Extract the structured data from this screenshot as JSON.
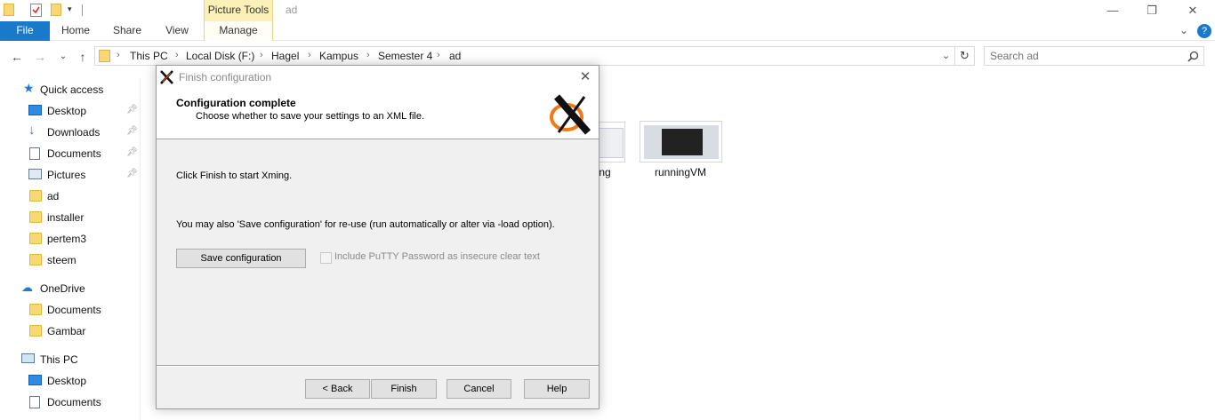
{
  "window": {
    "title": "ad",
    "context_tab": "Picture Tools",
    "controls": {
      "minimize": "—",
      "restore": "❐",
      "close": "✕"
    }
  },
  "ribbon": {
    "tabs": [
      "File",
      "Home",
      "Share",
      "View",
      "Manage"
    ],
    "expand_glyph": "⌄",
    "help_glyph": "?"
  },
  "address": {
    "crumbs": [
      "This PC",
      "Local Disk (F:)",
      "Hagel",
      "Kampus",
      "Semester 4",
      "ad"
    ],
    "search_placeholder": "Search ad"
  },
  "sidebar": {
    "quick_access": "Quick access",
    "quick_items": [
      {
        "label": "Desktop",
        "icon": "desktop-icon",
        "pinned": true
      },
      {
        "label": "Downloads",
        "icon": "download-icon",
        "pinned": true
      },
      {
        "label": "Documents",
        "icon": "documents-icon",
        "pinned": true
      },
      {
        "label": "Pictures",
        "icon": "pictures-icon",
        "pinned": true
      },
      {
        "label": "ad",
        "icon": "folder-icon",
        "pinned": false
      },
      {
        "label": "installer",
        "icon": "folder-icon",
        "pinned": false
      },
      {
        "label": "pertem3",
        "icon": "folder-icon",
        "pinned": false
      },
      {
        "label": "steem",
        "icon": "folder-icon",
        "pinned": false
      }
    ],
    "onedrive": "OneDrive",
    "onedrive_items": [
      "Documents",
      "Gambar"
    ],
    "thispc": "This PC",
    "thispc_items": [
      "Desktop",
      "Documents"
    ]
  },
  "content": {
    "files": [
      {
        "name": "rding"
      },
      {
        "name": "runningVM"
      }
    ]
  },
  "dialog": {
    "title": "Finish configuration",
    "heading": "Configuration complete",
    "subheading": "Choose whether to save your settings to an XML file.",
    "line1": "Click Finish to start Xming.",
    "line2": "You may also 'Save configuration' for re-use (run automatically or alter via -load option).",
    "save_button": "Save configuration",
    "checkbox_label": "Include PuTTY Password as insecure clear text",
    "checkbox_checked": false,
    "buttons": {
      "back": "< Back",
      "finish": "Finish",
      "cancel": "Cancel",
      "help": "Help"
    }
  }
}
